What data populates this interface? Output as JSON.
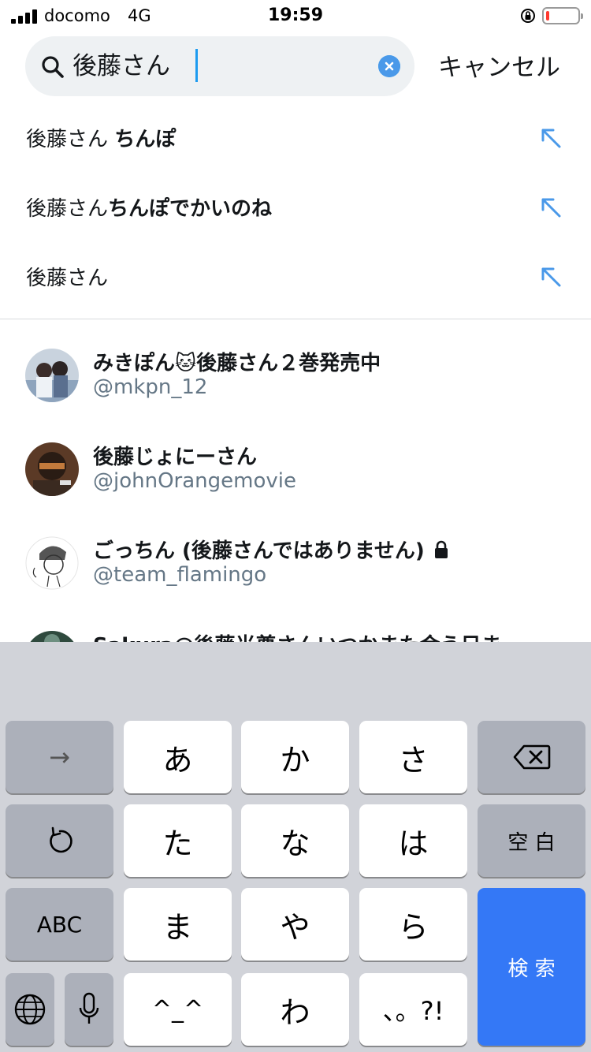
{
  "status_bar": {
    "carrier": "docomo",
    "network": "4G",
    "time": "19:59",
    "battery_level_percent": 10
  },
  "search": {
    "query": "後藤さん",
    "cancel_label": "キャンセル"
  },
  "suggestions": [
    {
      "normal": "後藤さん ",
      "bold": "ちんぽ"
    },
    {
      "normal": "後藤さん",
      "bold": "ちんぽでかいのね"
    },
    {
      "normal": "後藤さん",
      "bold": ""
    }
  ],
  "users": [
    {
      "name": "みきぽん🐱後藤さん２巻発売中",
      "handle": "@mkpn_12",
      "protected": false
    },
    {
      "name": "後藤じょにーさん",
      "handle": "@johnOrangemovie",
      "protected": false
    },
    {
      "name": "ごっちん (後藤さんではありません)",
      "handle": "@team_flamingo",
      "protected": true
    },
    {
      "name": "Sakura@後藤光尊さんいつかまた会う日ま…",
      "handle": "",
      "protected": false
    }
  ],
  "keyboard": {
    "row1": [
      "→",
      "あ",
      "か",
      "さ"
    ],
    "row2": [
      "た",
      "な",
      "は",
      "空 白"
    ],
    "row3": [
      "ABC",
      "ま",
      "や",
      "ら"
    ],
    "row4": [
      "^_^",
      "わ",
      "、。?!"
    ],
    "search_key": "検 索"
  },
  "colors": {
    "accent": "#1d9bf0",
    "handle": "#657786",
    "keyboard_bg": "#d1d3d9",
    "search_key": "#3478f6"
  }
}
